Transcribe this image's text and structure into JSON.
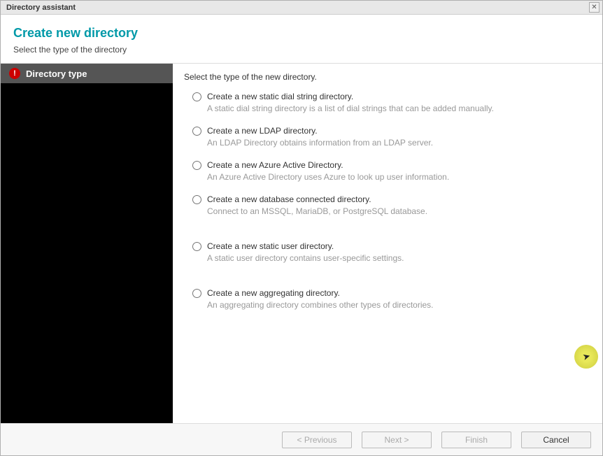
{
  "window": {
    "title": "Directory assistant"
  },
  "header": {
    "title": "Create new directory",
    "subtitle": "Select the type of the directory"
  },
  "sidebar": {
    "items": [
      {
        "label": "Directory type",
        "alert": true
      }
    ]
  },
  "main": {
    "instruction": "Select the type of the new directory.",
    "options": [
      {
        "label": "Create a new static dial string directory.",
        "desc": "A static dial string directory is a list of dial strings that can be added manually."
      },
      {
        "label": "Create a new LDAP directory.",
        "desc": "An LDAP Directory obtains information from an LDAP server."
      },
      {
        "label": "Create a new Azure Active Directory.",
        "desc": "An Azure Active Directory uses Azure to look up user information."
      },
      {
        "label": "Create a new database connected directory.",
        "desc": "Connect to an MSSQL, MariaDB, or PostgreSQL database."
      },
      {
        "label": "Create a new static user directory.",
        "desc": "A static user directory contains user-specific settings."
      },
      {
        "label": "Create a new aggregating directory.",
        "desc": "An aggregating directory combines other types of directories."
      }
    ]
  },
  "footer": {
    "previous": "< Previous",
    "next": "Next >",
    "finish": "Finish",
    "cancel": "Cancel"
  }
}
